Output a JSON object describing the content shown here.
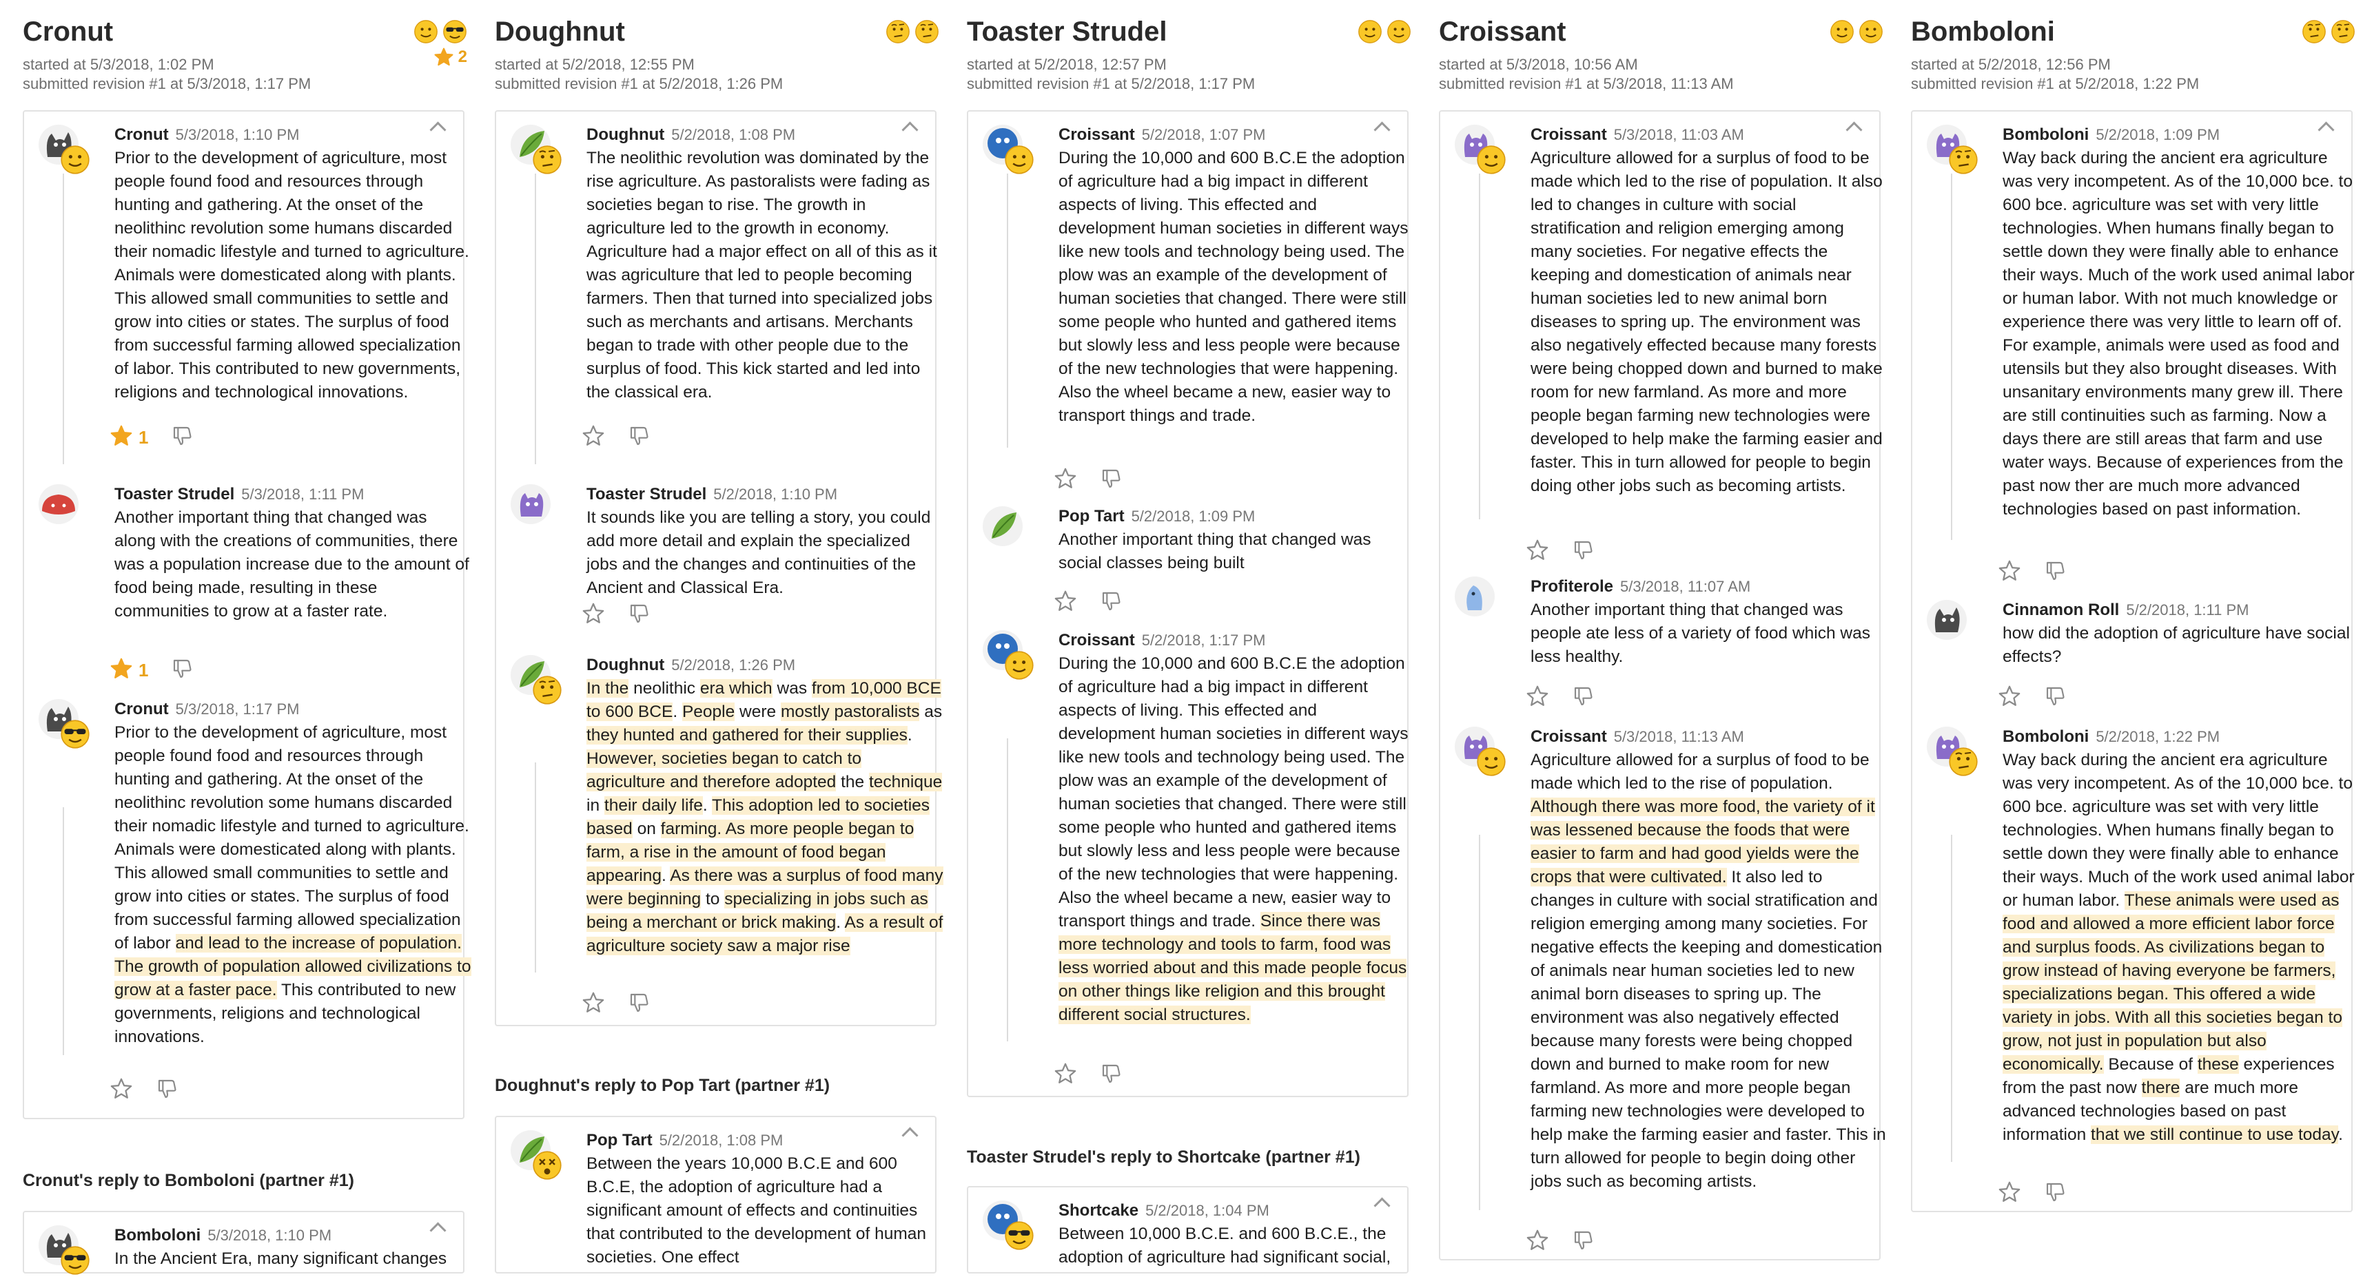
{
  "columns": [
    {
      "title": "Cronut",
      "started": "started at 5/3/2018, 1:02 PM",
      "submitted": "submitted revision #1 at 5/3/2018, 1:17 PM",
      "star_count": "2",
      "posts": [
        {
          "author": "Cronut",
          "date": "5/3/2018, 1:10 PM",
          "star_count": "1",
          "body": [
            {
              "t": "Prior to the development of agriculture, most people found food and resources through hunting and gathering. At the onset of the neolithinc revolution some humans discarded their nomadic lifestyle and turned to agriculture. Animals were domesticated along with plants. This allowed small communities to settle and grow into cities or states. The surplus of food from successful farming allowed specialization of labor. This contributed to new governments, religions and technological innovations."
            }
          ]
        },
        {
          "author": "Toaster Strudel",
          "date": "5/3/2018, 1:11 PM",
          "star_count": "1",
          "body": [
            {
              "t": "Another important thing that changed was along with the creations of communities, there was a population increase due to the amount of food being made, resulting in these communities to grow at a faster rate."
            }
          ]
        },
        {
          "author": "Cronut",
          "date": "5/3/2018, 1:17 PM",
          "body": [
            {
              "t": "Prior to the development of agriculture, most people found food and resources through hunting and gathering. At the onset of the neolithinc revolution some humans discarded their nomadic lifestyle and turned to agriculture. Animals were domesticated along with plants. This allowed small communities to settle and grow into cities or states. The surplus of food from successful farming allowed specialization of labor "
            },
            {
              "t": "and lead to the increase of population. The growth of population allowed civilizations to grow at a faster pace.",
              "h": true
            },
            {
              "t": " This contributed to new governments, religions and technological innovations."
            }
          ]
        }
      ],
      "reply_label": "Cronut's reply to Bomboloni (partner #1)",
      "reply_posts": [
        {
          "author": "Bomboloni",
          "date": "5/3/2018, 1:10 PM",
          "body": [
            {
              "t": "In the Ancient Era, many significant changes"
            }
          ]
        }
      ]
    },
    {
      "title": "Doughnut",
      "started": "started at 5/2/2018, 12:55 PM",
      "submitted": "submitted revision #1 at 5/2/2018, 1:26 PM",
      "posts": [
        {
          "author": "Doughnut",
          "date": "5/2/2018, 1:08 PM",
          "body": [
            {
              "t": "The neolithic revolution was dominated by the rise agriculture. As pastoralists were fading as societies began to rise. The growth in agriculture led to the growth in economy. Agriculture had a major effect on all of this as it was agriculture that led to people becoming farmers. Then that turned into specialized jobs such as merchants and artisans. Merchants began to trade with other people due to the surplus of food. This kick started and led into the classical era."
            }
          ]
        },
        {
          "author": "Toaster Strudel",
          "date": "5/2/2018, 1:10 PM",
          "body": [
            {
              "t": "It sounds like you are telling a story, you could add more detail and explain the specialized jobs and the changes and continuities of the Ancient and Classical Era."
            }
          ]
        },
        {
          "author": "Doughnut",
          "date": "5/2/2018, 1:26 PM",
          "body": [
            {
              "t": "In the",
              "h": true
            },
            {
              "t": " neolithic "
            },
            {
              "t": "era which",
              "h": true
            },
            {
              "t": " was "
            },
            {
              "t": "from 10,000 BCE to 600 BCE",
              "h": true
            },
            {
              "t": ". "
            },
            {
              "t": "People",
              "h": true
            },
            {
              "t": " were "
            },
            {
              "t": "mostly pastoralists",
              "h": true
            },
            {
              "t": " as "
            },
            {
              "t": "they hunted and gathered for their supplies",
              "h": true
            },
            {
              "t": ". "
            },
            {
              "t": "However, societies began to catch to agriculture and therefore adopted",
              "h": true
            },
            {
              "t": " the "
            },
            {
              "t": "technique",
              "h": true
            },
            {
              "t": " in "
            },
            {
              "t": "their daily life",
              "h": true
            },
            {
              "t": ". "
            },
            {
              "t": "This adoption led to societies based",
              "h": true
            },
            {
              "t": " on "
            },
            {
              "t": "farming. As more people began to farm, a rise in the amount of food began appearing",
              "h": true
            },
            {
              "t": ". "
            },
            {
              "t": "As there was a surplus of food many were beginning",
              "h": true
            },
            {
              "t": " to "
            },
            {
              "t": "specializing in jobs such as being a merchant or brick making",
              "h": true
            },
            {
              "t": ". "
            },
            {
              "t": "As a result of agriculture society saw a major rise",
              "h": true
            }
          ]
        }
      ],
      "reply_label": "Doughnut's reply to Pop Tart (partner #1)",
      "reply_posts": [
        {
          "author": "Pop Tart",
          "date": "5/2/2018, 1:08 PM",
          "body": [
            {
              "t": "Between the years 10,000 B.C.E and 600 B.C.E, the adoption of agriculture had a significant amount of effects and continuities that contributed to the development of human societies. One effect"
            }
          ]
        }
      ]
    },
    {
      "title": "Toaster Strudel",
      "started": "started at 5/2/2018, 12:57 PM",
      "submitted": "submitted revision #1 at 5/2/2018, 1:17 PM",
      "posts": [
        {
          "author": "Croissant",
          "date": "5/2/2018, 1:07 PM",
          "body": [
            {
              "t": "During the 10,000 and 600 B.C.E the adoption of agriculture had a big impact in different aspects of living. This effected and development human societies in different ways like new tools and technology being used. The plow was an example of the development of human societies that changed. There were still some people who hunted and gathered items but slowly less and less people were because of the new technologies that were happening. Also the wheel became a new, easier way to transport things and trade."
            }
          ]
        },
        {
          "author": "Pop Tart",
          "date": "5/2/2018, 1:09 PM",
          "body": [
            {
              "t": "Another important thing that changed was social classes being built"
            }
          ]
        },
        {
          "author": "Croissant",
          "date": "5/2/2018, 1:17 PM",
          "body": [
            {
              "t": "During the 10,000 and 600 B.C.E the adoption of agriculture had a big impact in different aspects of living. This effected and development human societies in different ways like new tools and technology being used. The plow was an example of the development of human societies that changed. There were still some people who hunted and gathered items but slowly less and less people were because of the new technologies that were happening. Also the wheel became a new, easier way to transport things and trade. "
            },
            {
              "t": "Since there was more technology and tools to farm, food was less worried about and this made people focus on other things like religion and this brought different social structures.",
              "h": true
            }
          ]
        }
      ],
      "reply_label": "Toaster Strudel's reply to Shortcake (partner #1)",
      "reply_posts": [
        {
          "author": "Shortcake",
          "date": "5/2/2018, 1:04 PM",
          "body": [
            {
              "t": "Between 10,000 B.C.E. and 600 B.C.E., the adoption of agriculture had significant social,"
            }
          ]
        }
      ]
    },
    {
      "title": "Croissant",
      "started": "started at 5/3/2018, 10:56 AM",
      "submitted": "submitted revision #1 at 5/3/2018, 11:13 AM",
      "posts": [
        {
          "author": "Croissant",
          "date": "5/3/2018, 11:03 AM",
          "body": [
            {
              "t": "Agriculture allowed for a surplus of food to be made which led to the rise of population. It also led to changes in culture with social stratification and religion emerging among many societies. For negative effects the keeping and domestication of animals near human societies led to new animal born diseases to spring up. The environment was also negatively effected because many forests were being chopped down and burned to make room for new farmland. As more and more people began farming new technologies were developed to help make the farming easier and faster. This in turn allowed for people to begin doing other jobs such as becoming artists."
            }
          ]
        },
        {
          "author": "Profiterole",
          "date": "5/3/2018, 11:07 AM",
          "body": [
            {
              "t": "Another important thing that changed was people ate less of a variety of food which was less healthy."
            }
          ]
        },
        {
          "author": "Croissant",
          "date": "5/3/2018, 11:13 AM",
          "body": [
            {
              "t": "Agriculture allowed for a surplus of food to be made which led to the rise of population. "
            },
            {
              "t": "Although there was more food, the variety of it was lessened because the foods that were easier to farm and had good yields were the crops that were cultivated.",
              "h": true
            },
            {
              "t": " It also led to changes in culture with social stratification and religion emerging among many societies. For negative effects the keeping and domestication of animals near human societies led to new animal born diseases to spring up. The environment was also negatively effected because many forests were being chopped down and burned to make room for new farmland. As more and more people began farming new technologies were developed to help make the farming easier and faster. This in turn allowed for people to begin doing other jobs such as becoming artists."
            }
          ]
        }
      ]
    },
    {
      "title": "Bomboloni",
      "started": "started at 5/2/2018, 12:56 PM",
      "submitted": "submitted revision #1 at 5/2/2018, 1:22 PM",
      "posts": [
        {
          "author": "Bomboloni",
          "date": "5/2/2018, 1:09 PM",
          "body": [
            {
              "t": "Way back during the ancient era agriculture was very incompetent. As of the 10,000 bce. to 600 bce. agriculture was set with very little technologies. When humans finally began to settle down they were finally able to enhance their ways. Much of the work used animal labor or human labor. With not much knowledge or experience there was very little to learn off of. For example, animals were used as food and utensils but they also brought diseases. With unsanitary environments many grew ill. There are still continuities such as farming. Now a days there are still areas that farm and use water ways. Because of experiences from the past now ther are much more advanced technologies based on past information."
            }
          ]
        },
        {
          "author": "Cinnamon Roll",
          "date": "5/2/2018, 1:11 PM",
          "body": [
            {
              "t": "how did the adoption of agriculture have social effects?"
            }
          ]
        },
        {
          "author": "Bomboloni",
          "date": "5/2/2018, 1:22 PM",
          "body": [
            {
              "t": "Way back during the ancient era agriculture was very incompetent. As of the 10,000 bce. to 600 bce. agriculture was set with very little technologies. When humans finally began to settle down they were finally able to enhance their ways. Much of the work used animal labor or human labor. "
            },
            {
              "t": "These animals were used as food and allowed a more efficient labor force and surplus foods. As civilizations began to grow instead of having everyone be farmers, specializations began. This offered a wide variety in jobs. With all this societies began to grow, not just in population but also economically.",
              "h": true
            },
            {
              "t": " Because of "
            },
            {
              "t": "these",
              "h": true
            },
            {
              "t": " experiences from the past now "
            },
            {
              "t": "there",
              "h": true
            },
            {
              "t": " are much more advanced technologies based on past information "
            },
            {
              "t": "that we still continue to use today",
              "h": true
            },
            {
              "t": "."
            }
          ]
        }
      ]
    }
  ]
}
